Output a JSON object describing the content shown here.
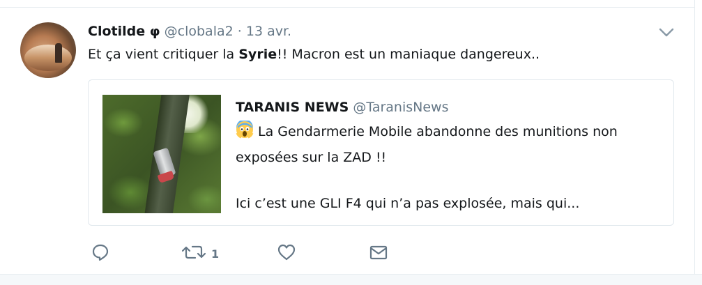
{
  "tweet": {
    "author": {
      "name": "Clotilde φ",
      "handle": "@clobala2",
      "separator": "·",
      "timestamp": "13 avr.",
      "avatar_icon": "avatar-photo"
    },
    "text": {
      "before": "Et ça vient critiquer la ",
      "bold": "Syrie",
      "after": "!! Macron est un maniaque  dangereux.."
    },
    "menu_icon": "chevron-down-icon"
  },
  "quoted_tweet": {
    "name": "TARANIS NEWS",
    "handle": "@TaranisNews",
    "emoji_icon": "face-screaming-emoji",
    "line1": "La Gendarmerie Mobile abandonne des munitions non",
    "line2": "exposées sur la ZAD !!",
    "line3": "Ici c’est une GLI F4 qui n’a pas explosée, mais qui..."
  },
  "actions": {
    "reply_icon": "reply-icon",
    "retweet_icon": "retweet-icon",
    "retweet_count": "1",
    "like_icon": "heart-icon",
    "dm_icon": "envelope-icon"
  },
  "colors": {
    "text": "#14171a",
    "muted": "#657786",
    "border": "#e1e8ed"
  }
}
